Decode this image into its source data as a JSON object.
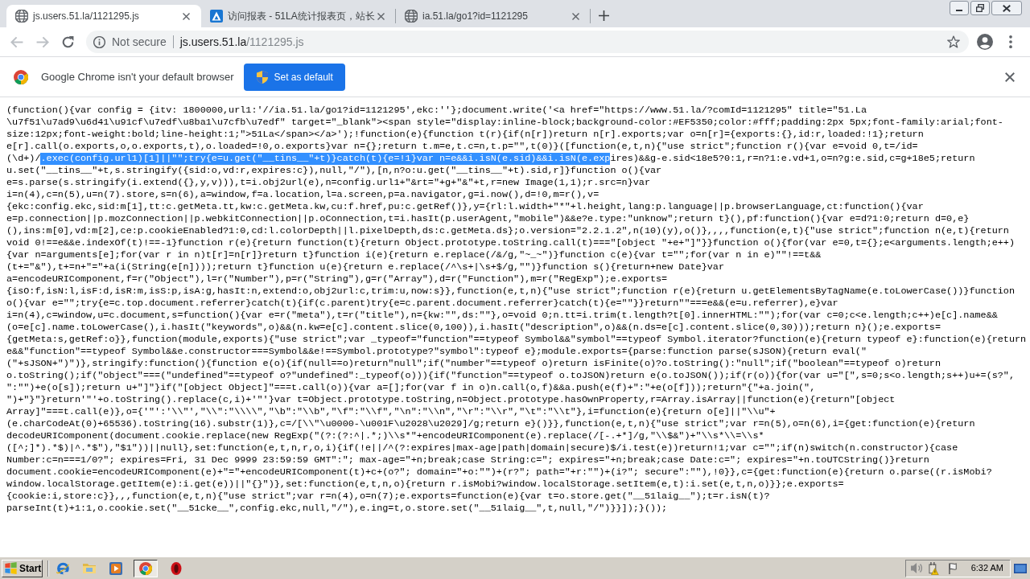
{
  "tabs": [
    {
      "title": "js.users.51.la/1121295.js",
      "kind": "page",
      "selected": true
    },
    {
      "title": "访问报表 - 51LA统计报表页，站长",
      "kind": "site",
      "selected": false
    },
    {
      "title": "ia.51.la/go1?id=1121295",
      "kind": "page",
      "selected": false
    }
  ],
  "toolbar": {
    "navigation": [
      {
        "kind": "back",
        "disabled": true
      },
      {
        "kind": "forward",
        "disabled": true
      },
      {
        "kind": "reload",
        "disabled": false
      }
    ],
    "security": "Not secure",
    "url": {
      "host": "js.users.51.la",
      "path": "/1121295.js"
    }
  },
  "infobar": {
    "message": "Google Chrome isn't your default browser",
    "button": "Set as default"
  },
  "document": {
    "lines": [
      {
        "segments": [
          {
            "text": "(function(){var config = {itv: 1800000,url1:'//ia.51.la/go1?id=1121295',ekc:''};document.write('<a href=\"https://www.51.la/?comId=1121295\" title=\"51.La",
            "selected": false
          }
        ]
      },
      {
        "segments": [
          {
            "text": "\\u7f51\\u7ad9\\u6d41\\u91cf\\u7edf\\u8ba1\\u7cfb\\u7edf\" target=\"_blank\"><span style=\"display:inline-block;background-color:#EF5350;color:#fff;padding:2px 5px;font-family:arial;font-",
            "selected": false
          }
        ]
      },
      {
        "segments": [
          {
            "text": "size:12px;font-weight:bold;line-height:1;\">51La</span></a>');!function(e){function t(r){if(n[r])return n[r].exports;var o=n[r]={exports:{},id:r,loaded:!1};return",
            "selected": false
          }
        ]
      },
      {
        "segments": [
          {
            "text": "e[r].call(o.exports,o,o.exports,t),o.loaded=!0,o.exports}var n={};return t.m=e,t.c=n,t.p=\"\",t(0)}([function(e,t,n){\"use strict\";function r(){var e=void 0,t=/id=",
            "selected": false
          }
        ]
      },
      {
        "segments": [
          {
            "text": "(\\d+)/",
            "selected": false
          },
          {
            "text": ".exec(config.url1)[1]||\"\";try{e=u.get(\"__tins__\"+t)}catch(t){e=!1}var n=e&&i.isN(e.sid)&&i.isN(e.exp",
            "selected": true
          },
          {
            "text": "ires)&&g-e.sid<18e5?0:1,r=n?1:e.vd+1,o=n?g:e.sid,c=g+18e5;return",
            "selected": false
          }
        ]
      },
      {
        "segments": [
          {
            "text": "u.set(\"__tins__\"+t,s.stringify({sid:o,vd:r,expires:c}),null,\"/\"),[n,n?o:u.get(\"__tins__\"+t).sid,r]}function o(){var",
            "selected": false
          }
        ]
      },
      {
        "segments": [
          {
            "text": "e=s.parse(s.stringify(i.extend({},y,v))),t=i.obj2url(e),n=config.url1+\"&rt=\"+g+\"&\"+t,r=new Image(1,1);r.src=n}var",
            "selected": false
          }
        ]
      },
      {
        "segments": [
          {
            "text": "i=n(4),c=n(5),u=n(7).store,s=n(6),a=window,f=a.location,l=a.screen,p=a.navigator,g=i.now(),d=!0,m=r(),v=",
            "selected": false
          }
        ]
      },
      {
        "segments": [
          {
            "text": "{ekc:config.ekc,sid:m[1],tt:c.getMeta.tt,kw:c.getMeta.kw,cu:f.href,pu:c.getRef()},y={rl:l.width+\"*\"+l.height,lang:p.language||p.browserLanguage,ct:function(){var",
            "selected": false
          }
        ]
      },
      {
        "segments": [
          {
            "text": "e=p.connection||p.mozConnection||p.webkitConnection||p.oConnection,t=i.hasIt(p.userAgent,\"mobile\")&&e?e.type:\"unknow\";return t}(),pf:function(){var e=d?1:0;return d=0,e}",
            "selected": false
          }
        ]
      },
      {
        "segments": [
          {
            "text": "(),ins:m[0],vd:m[2],ce:p.cookieEnabled?1:0,cd:l.colorDepth||l.pixelDepth,ds:c.getMeta.ds};o.version=\"2.2.1.2\",n(10)(y),o()},,,,function(e,t){\"use strict\";function n(e,t){return",
            "selected": false
          }
        ]
      },
      {
        "segments": [
          {
            "text": "void 0!==e&&e.indexOf(t)!==-1}function r(e){return function(t){return Object.prototype.toString.call(t)===\"[object \"+e+\"]\"}}function o(){for(var e=0,t={};e<arguments.length;e++)",
            "selected": false
          }
        ]
      },
      {
        "segments": [
          {
            "text": "{var n=arguments[e];for(var r in n)t[r]=n[r]}return t}function i(e){return e.replace(/&/g,\"~_~\")}function c(e){var t=\"\";for(var n in e)\"\"!==t&&",
            "selected": false
          }
        ]
      },
      {
        "segments": [
          {
            "text": "(t+=\"&\"),t+=n+\"=\"+a(i(String(e[n])));return t}function u(e){return e.replace(/^\\s+|\\s+$/g,\"\")}function s(){return+new Date}var",
            "selected": false
          }
        ]
      },
      {
        "segments": [
          {
            "text": "a=encodeURIComponent,f=r(\"Object\"),l=r(\"Number\"),p=r(\"String\"),g=r(\"Array\"),d=r(\"Function\"),m=r(\"RegExp\");e.exports=",
            "selected": false
          }
        ]
      },
      {
        "segments": [
          {
            "text": "{isO:f,isN:l,isF:d,isR:m,isS:p,isA:g,hasIt:n,extend:o,obj2url:c,trim:u,now:s}},function(e,t,n){\"use strict\";function r(e){return u.getElementsByTagName(e.toLowerCase())}function",
            "selected": false
          }
        ]
      },
      {
        "segments": [
          {
            "text": "o(){var e=\"\";try{e=c.top.document.referrer}catch(t){if(c.parent)try{e=c.parent.document.referrer}catch(t){e=\"\"}}return\"\"===e&&(e=u.referrer),e}var",
            "selected": false
          }
        ]
      },
      {
        "segments": [
          {
            "text": "i=n(4),c=window,u=c.document,s=function(){var e=r(\"meta\"),t=r(\"title\"),n={kw:\"\",ds:\"\"},o=void 0;n.tt=i.trim(t.length?t[0].innerHTML:\"\");for(var c=0;c<e.length;c++)e[c].name&&",
            "selected": false
          }
        ]
      },
      {
        "segments": [
          {
            "text": "(o=e[c].name.toLowerCase(),i.hasIt(\"keywords\",o)&&(n.kw=e[c].content.slice(0,100)),i.hasIt(\"description\",o)&&(n.ds=e[c].content.slice(0,30)));return n}();e.exports=",
            "selected": false
          }
        ]
      },
      {
        "segments": [
          {
            "text": "{getMeta:s,getRef:o}},function(module,exports){\"use strict\";var _typeof=\"function\"==typeof Symbol&&\"symbol\"==typeof Symbol.iterator?function(e){return typeof e}:function(e){return",
            "selected": false
          }
        ]
      },
      {
        "segments": [
          {
            "text": "e&&\"function\"==typeof Symbol&&e.constructor===Symbol&&e!==Symbol.prototype?\"symbol\":typeof e};module.exports={parse:function parse(sJSON){return eval(\"",
            "selected": false
          }
        ]
      },
      {
        "segments": [
          {
            "text": "(\"+sJSON+\")\")},stringify:function(){function e(o){if(null==o)return\"null\";if(\"number\"==typeof o)return isFinite(o)?o.toString():\"null\";if(\"boolean\"==typeof o)return",
            "selected": false
          }
        ]
      },
      {
        "segments": [
          {
            "text": "o.toString();if(\"object\"===(\"undefined\"==typeof o?\"undefined\":_typeof(o))){if(\"function\"==typeof o.toJSON)return e(o.toJSON());if(r(o)){for(var u=\"[\",s=0;s<o.length;s++)u+=(s?\",",
            "selected": false
          }
        ]
      },
      {
        "segments": [
          {
            "text": "\":\"\")+e(o[s]);return u+\"]\"}if(\"[object Object]\"===t.call(o)){var a=[];for(var f in o)n.call(o,f)&&a.push(e(f)+\":\"+e(o[f]));return\"{\"+a.join(\",",
            "selected": false
          }
        ]
      },
      {
        "segments": [
          {
            "text": "\")+\"}\"}return'\"'+o.toString().replace(c,i)+'\"'}var t=Object.prototype.toString,n=Object.prototype.hasOwnProperty,r=Array.isArray||function(e){return\"[object",
            "selected": false
          }
        ]
      },
      {
        "segments": [
          {
            "text": "Array]\"===t.call(e)},o={'\"':'\\\\\"',\"\\\\\":\"\\\\\\\\\",\"\\b\":\"\\\\b\",\"\\f\":\"\\\\f\",\"\\n\":\"\\\\n\",\"\\r\":\"\\\\r\",\"\\t\":\"\\\\t\"},i=function(e){return o[e]||\"\\\\u\"+",
            "selected": false
          }
        ]
      },
      {
        "segments": [
          {
            "text": "(e.charCodeAt(0)+65536).toString(16).substr(1)},c=/[\\\\\"\\u0000-\\u001F\\u2028\\u2029]/g;return e}()}},function(e,t,n){\"use strict\";var r=n(5),o=n(6),i={get:function(e){return",
            "selected": false
          }
        ]
      },
      {
        "segments": [
          {
            "text": "decodeURIComponent(document.cookie.replace(new RegExp(\"(?:(?:^|.*;)\\\\s*\"+encodeURIComponent(e).replace(/[-.+*]/g,\"\\\\$&\")+\"\\\\s*\\\\=\\\\s*",
            "selected": false
          }
        ]
      },
      {
        "segments": [
          {
            "text": "([^;]*).*$)|^.*$\"),\"$1\"))||null},set:function(e,t,n,r,o,i){if(!e||/^(?:expires|max-age|path|domain|secure)$/i.test(e))return!1;var c=\"\";if(n)switch(n.constructor){case",
            "selected": false
          }
        ]
      },
      {
        "segments": [
          {
            "text": "Number:c=n===1/0?\"; expires=Fri, 31 Dec 9999 23:59:59 GMT\":\"; max-age=\"+n;break;case String:c=\"; expires=\"+n;break;case Date:c=\"; expires=\"+n.toUTCString()}return",
            "selected": false
          }
        ]
      },
      {
        "segments": [
          {
            "text": "document.cookie=encodeURIComponent(e)+\"=\"+encodeURIComponent(t)+c+(o?\"; domain=\"+o:\"\")+(r?\"; path=\"+r:\"\")+(i?\"; secure\":\"\"),!0}},c={get:function(e){return o.parse((r.isMobi?",
            "selected": false
          }
        ]
      },
      {
        "segments": [
          {
            "text": "window.localStorage.getItem(e):i.get(e))||\"{}\")},set:function(e,t,n,o){return r.isMobi?window.localStorage.setItem(e,t):i.set(e,t,n,o)}};e.exports=",
            "selected": false
          }
        ]
      },
      {
        "segments": [
          {
            "text": "{cookie:i,store:c}},,,function(e,t,n){\"use strict\";var r=n(4),o=n(7);e.exports=function(e){var t=o.store.get(\"__51laig__\");t=r.isN(t)?",
            "selected": false
          }
        ]
      },
      {
        "segments": [
          {
            "text": "parseInt(t)+1:1,o.cookie.set(\"__51cke__\",config.ekc,null,\"/\"),e.ing=t,o.store.set(\"__51laig__\",t,null,\"/\")}}]);}());",
            "selected": false
          }
        ]
      }
    ]
  },
  "taskbar": {
    "start": "Start",
    "buttons": [
      {
        "kind": "ie",
        "selected": false
      },
      {
        "kind": "folder",
        "selected": false
      },
      {
        "kind": "media",
        "selected": false
      },
      {
        "kind": "chrome",
        "selected": true
      },
      {
        "kind": "ring",
        "selected": false
      }
    ],
    "clock": "6:32 AM"
  }
}
